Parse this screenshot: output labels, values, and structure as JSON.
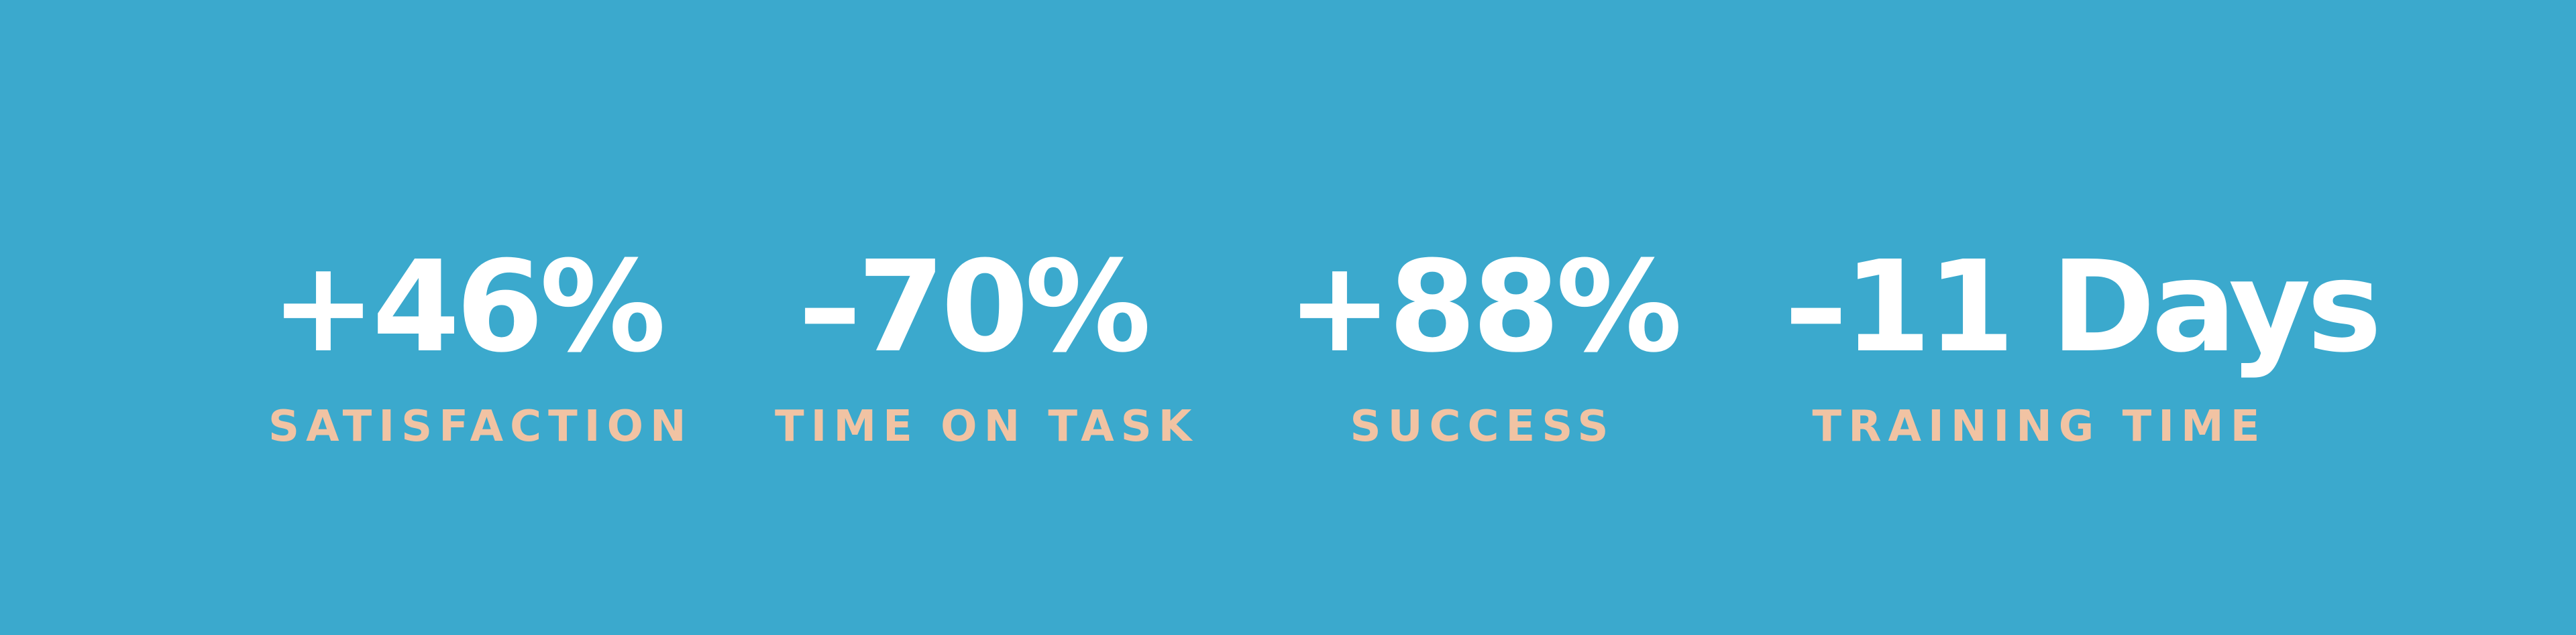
{
  "background_color": "#3ba9cd",
  "value_color": "#ffffff",
  "label_color": "#f1c3a3",
  "stats": [
    {
      "value": "+46%",
      "label": "SATISFACTION"
    },
    {
      "value": "–70%",
      "label": "TIME ON TASK"
    },
    {
      "value": "+88%",
      "label": "SUCCESS"
    },
    {
      "value": "–11 Days",
      "label": "TRAINING TIME"
    }
  ]
}
